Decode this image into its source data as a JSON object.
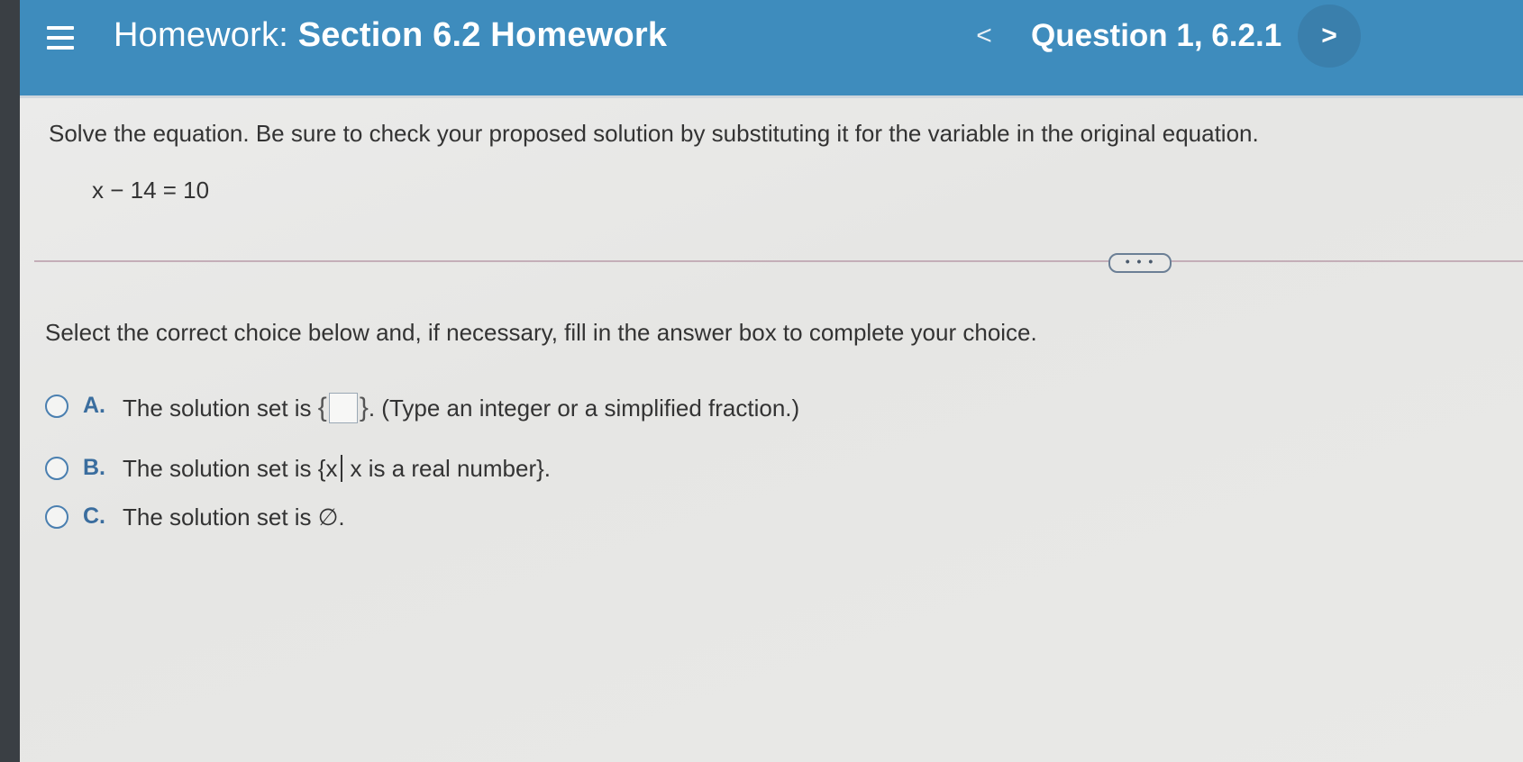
{
  "header": {
    "title_prefix": "Homework:",
    "title_name": "Section 6.2 Homework",
    "prev_label": "<",
    "question_label": "Question 1, 6.2.1",
    "next_label": ">"
  },
  "problem": {
    "instructions": "Solve the equation.  Be sure to check your proposed solution by substituting it for the variable in the original equation.",
    "equation": "x − 14 = 10",
    "expand_label": "• • •"
  },
  "answer": {
    "select_instructions": "Select the correct choice below and, if necessary, fill in the answer box to complete your choice.",
    "choices": [
      {
        "letter": "A.",
        "text_before": "The solution set is",
        "brace_open": "{",
        "brace_close": "}",
        "text_after": ". (Type an integer or a simplified fraction.)",
        "answer_value": ""
      },
      {
        "letter": "B.",
        "text_before": "The solution set is {x",
        "text_after": "x is a real number}."
      },
      {
        "letter": "C.",
        "text": "The solution set is ∅."
      }
    ]
  },
  "colors": {
    "header_bg": "#3e8cbd",
    "next_button_bg": "#3a7fac",
    "choice_letter": "#3a6d9e",
    "radio_border": "#4a7fb0"
  }
}
